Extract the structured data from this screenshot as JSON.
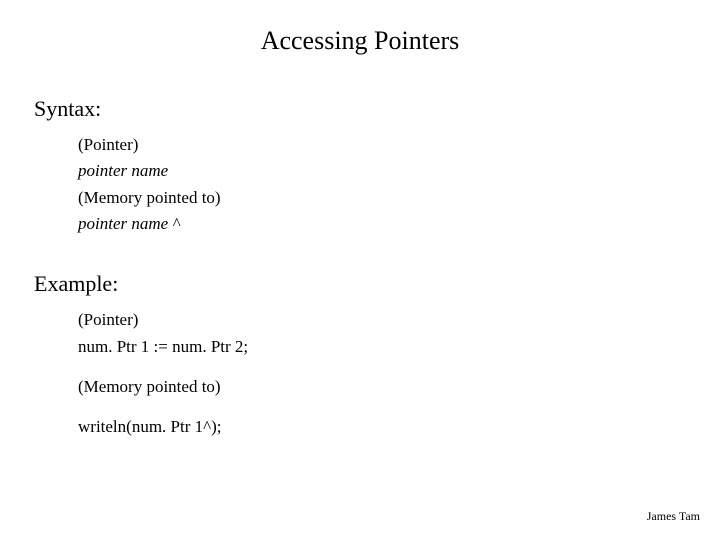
{
  "title": "Accessing Pointers",
  "syntax": {
    "heading": "Syntax:",
    "pointer_label": "(Pointer)",
    "pointer_name": "pointer name",
    "memory_label": "(Memory pointed to)",
    "memory_name": "pointer name ^"
  },
  "example": {
    "heading": "Example:",
    "pointer_label": "(Pointer)",
    "pointer_code": "num. Ptr 1 := num. Ptr 2;",
    "memory_label": "(Memory pointed to)",
    "memory_code": "writeln(num. Ptr 1^);"
  },
  "footer": "James Tam"
}
